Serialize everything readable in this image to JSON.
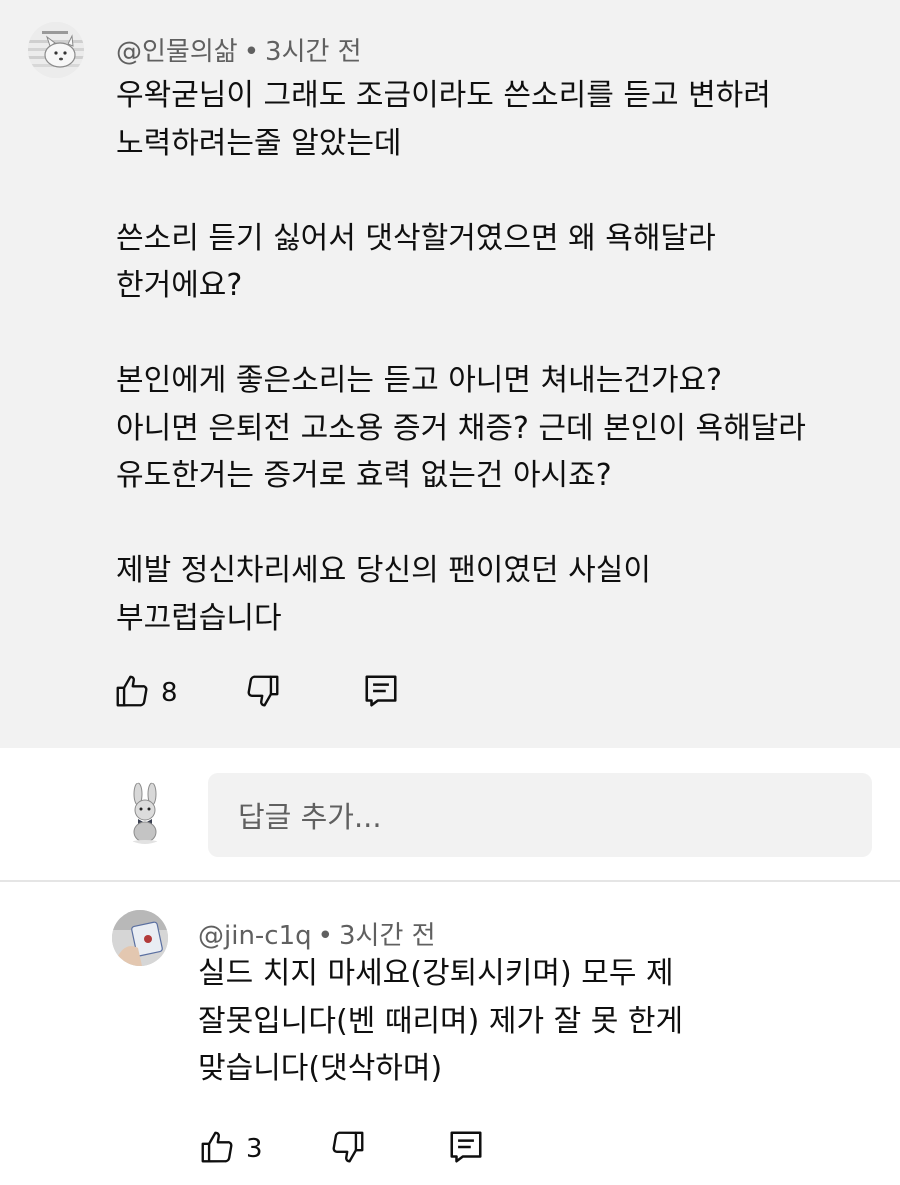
{
  "comment": {
    "author": "@인물의삶",
    "separator": "•",
    "time": "3시간 전",
    "body": "우왁굳님이 그래도 조금이라도 쓴소리를 듣고 변하려\n노력하려는줄 알았는데\n\n쓴소리 듣기 싫어서 댓삭할거였으면 왜 욕해달라\n한거에요?\n\n본인에게 좋은소리는 듣고 아니면 쳐내는건가요?\n아니면 은퇴전 고소용 증거 채증? 근데 본인이 욕해달라\n유도한거는 증거로 효력 없는건 아시죠?\n\n제발 정신차리세요 당신의 팬이였던 사실이\n부끄럽습니다",
    "likes": "8",
    "icons": {
      "like": "thumb-up-icon",
      "dislike": "thumb-down-icon",
      "reply": "reply-icon"
    }
  },
  "reply_input": {
    "placeholder": "답글 추가..."
  },
  "reply": {
    "author": "@jin-c1q",
    "separator": "•",
    "time": "3시간 전",
    "body": "실드 치지 마세요(강퇴시키며) 모두 제\n잘못입니다(벤 때리며) 제가 잘 못 한게\n맞습니다(댓삭하며)",
    "likes": "3"
  },
  "colors": {
    "background": "#ffffff",
    "highlight": "#f2f2f2",
    "meta": "#606060",
    "text": "#0f0f0f"
  }
}
